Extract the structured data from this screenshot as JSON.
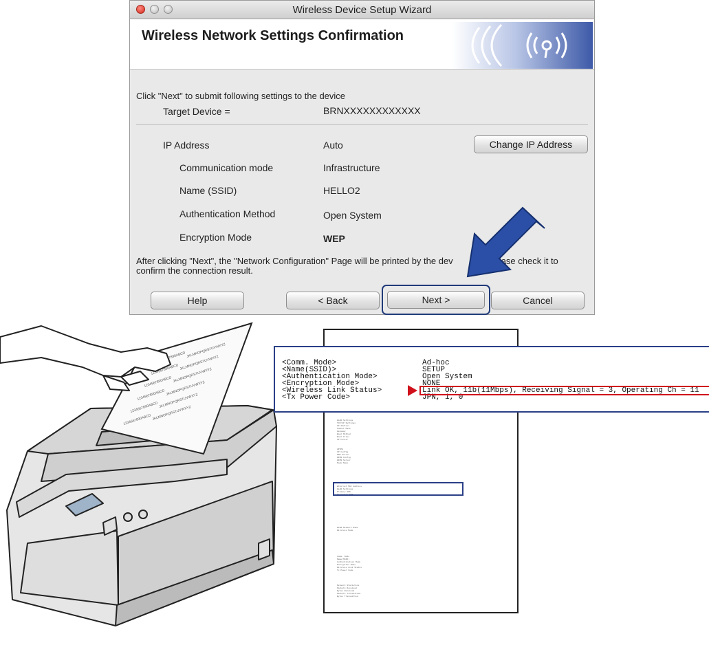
{
  "window": {
    "title": "Wireless Device Setup Wizard",
    "heading": "Wireless Network Settings Confirmation",
    "instruction": "Click \"Next\" to submit following settings to the device",
    "target_label": "Target Device =",
    "target_value": "BRNXXXXXXXXXXXX",
    "ip_label": "IP Address",
    "ip_value": "Auto",
    "change_ip_button": "Change IP Address",
    "settings": [
      {
        "label": "Communication mode",
        "value": "Infrastructure"
      },
      {
        "label": "Name (SSID)",
        "value": "HELLO2"
      },
      {
        "label": "Authentication Method",
        "value": "Open System"
      },
      {
        "label": "Encryption Mode",
        "value": "WEP"
      }
    ],
    "note_line1": "After clicking \"Next\", the \"Network Configuration\" Page will be printed by the dev",
    "note_line1_tail": "ase check it to",
    "note_line2": "confirm the connection result.",
    "buttons": {
      "help": "Help",
      "back": "< Back",
      "next": "Next >",
      "cancel": "Cancel"
    },
    "colors": {
      "window_bg": "#e9e9e9",
      "accent_blue": "#203b7a",
      "highlight_red": "#d0111b"
    }
  },
  "callout": {
    "labels": [
      "<Comm. Mode>",
      "<Name(SSID)>",
      "<Authentication Mode>",
      "<Encryption Mode>",
      "<Wireless Link Status>",
      "<Tx Power Code>"
    ],
    "values": [
      "Ad-hoc",
      "SETUP",
      "Open System",
      "NONE",
      "Link OK, 11b(11Mbps), Receiving Signal = 3, Operating Ch = 11",
      "JPN, 1, 0"
    ]
  },
  "paper_sheet_lines": [
    "1234567890ABCD",
    "JKLMNOPQRSTUVWXYZ"
  ]
}
